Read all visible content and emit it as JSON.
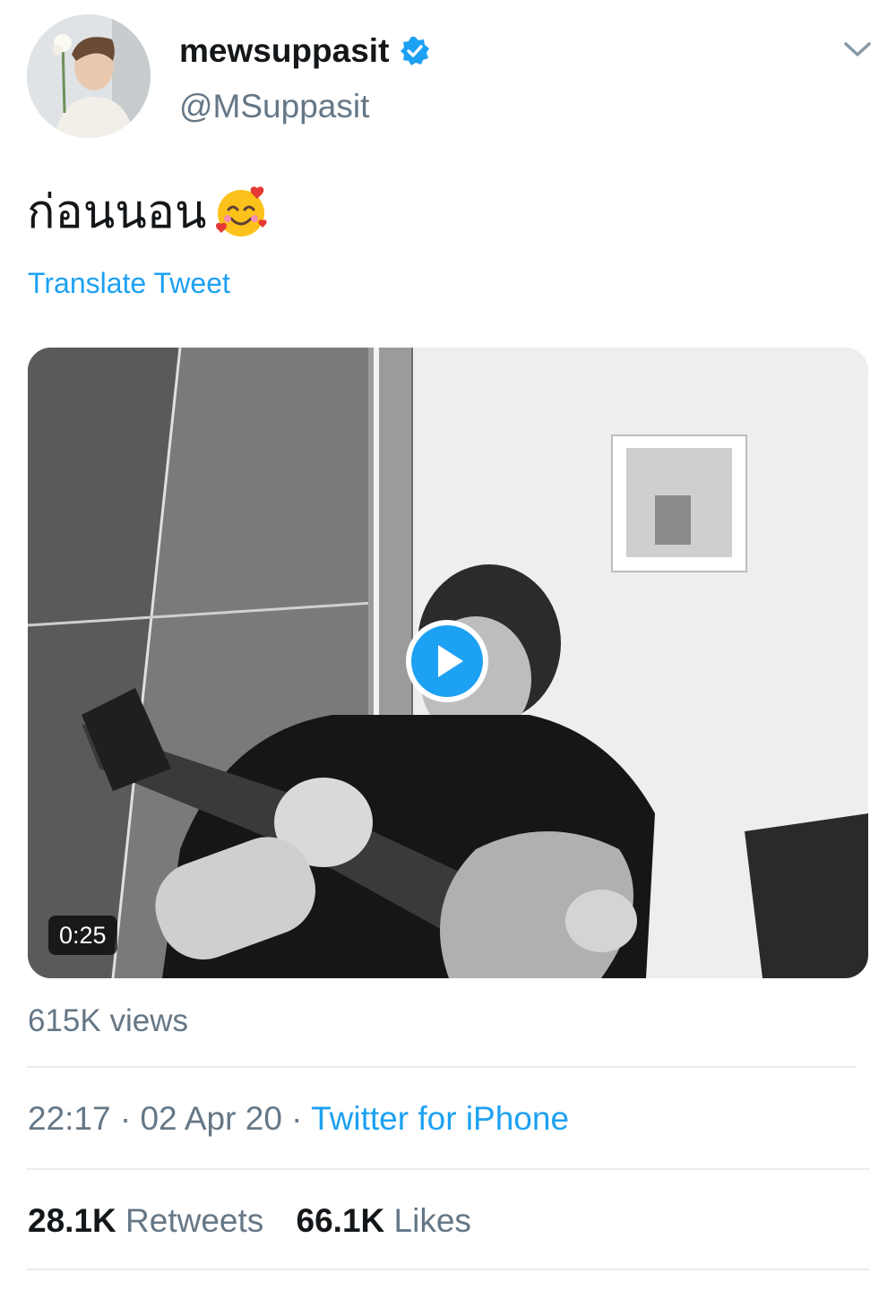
{
  "user": {
    "display_name": "mewsuppasit",
    "handle": "@MSuppasit",
    "verified": true
  },
  "tweet": {
    "text": "ก่อนนอน",
    "emoji": "smiling-face-with-hearts",
    "translate_label": "Translate Tweet"
  },
  "media": {
    "type": "video",
    "duration": "0:25"
  },
  "views": "615K views",
  "meta": {
    "time": "22:17",
    "sep1": "·",
    "date": "02 Apr 20",
    "sep2": "·",
    "source": "Twitter for iPhone"
  },
  "stats": {
    "retweets_count": "28.1K",
    "retweets_label": "Retweets",
    "likes_count": "66.1K",
    "likes_label": "Likes"
  },
  "colors": {
    "accent": "#1da1f2",
    "secondary_text": "#657786",
    "primary_text": "#14171a"
  }
}
